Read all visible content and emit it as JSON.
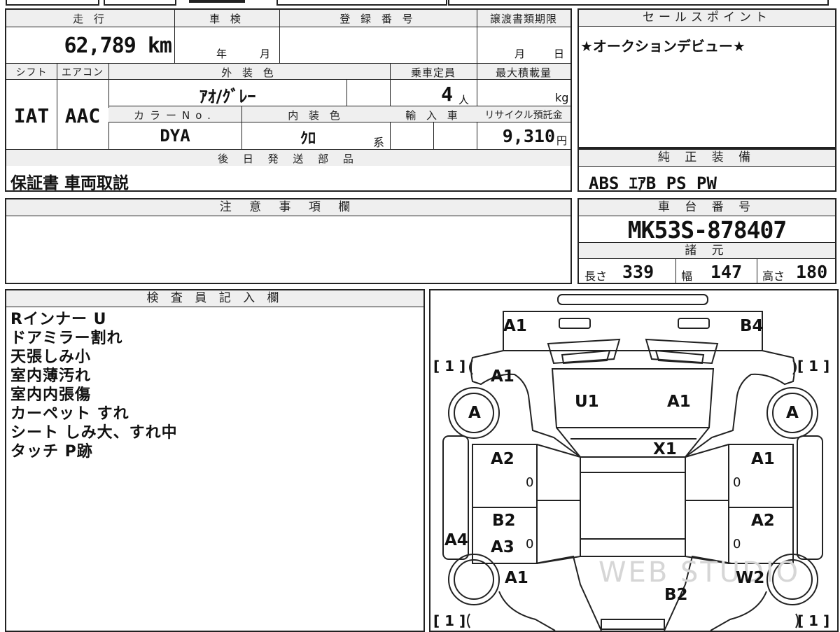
{
  "top_strip": {},
  "mileage": {
    "header": "走 行",
    "value": "62,789 km"
  },
  "inspection": {
    "header": "車 検",
    "year_unit": "年",
    "month_unit": "月"
  },
  "registration": {
    "header": "登 録 番 号"
  },
  "transfer_deadline": {
    "header": "譲渡書類期限",
    "month_unit": "月",
    "day_unit": "日"
  },
  "sales_point": {
    "header": "セールスポイント",
    "text": "★オークションデビュー★"
  },
  "shift": {
    "header": "シフト",
    "value": "IAT"
  },
  "aircon": {
    "header": "エアコン",
    "value": "AAC"
  },
  "exterior_color": {
    "header": "外 装 色",
    "value": "ｱｵ/ｸﾞﾚｰ"
  },
  "capacity": {
    "header": "乗車定員",
    "value": "4",
    "unit": "人"
  },
  "max_load": {
    "header": "最大積載量",
    "unit": "kg"
  },
  "color_no": {
    "header": "カラーNo.",
    "value": "DYA"
  },
  "interior_color": {
    "header": "内 装 色",
    "value": "ｸﾛ",
    "suffix": "系"
  },
  "import": {
    "header": "輸 入 車"
  },
  "recycle": {
    "header": "リサイクル預託金",
    "value": "9,310",
    "unit": "円"
  },
  "later_parts": {
    "header": "後 日 発 送 部 品",
    "value": "保証書 車両取説"
  },
  "genuine_equipment": {
    "header": "純 正 装 備",
    "value": "ABS ｴｱB PS PW"
  },
  "notes": {
    "header": "注 意 事 項 欄"
  },
  "chassis": {
    "header": "車 台 番 号",
    "value": "MK53S-878407"
  },
  "specs": {
    "header": "諸 元",
    "length_label": "長さ",
    "length": "339",
    "width_label": "幅",
    "width": "147",
    "height_label": "高さ",
    "height": "180"
  },
  "inspector": {
    "header": "検 査 員 記 入 欄",
    "lines": [
      "Rインナー U",
      "ドアミラー割れ",
      "天張しみ小",
      "室内薄汚れ",
      "室内内張傷",
      "カーペット すれ",
      "シート しみ大、すれ中",
      "タッチ P跡"
    ]
  },
  "diagram": {
    "watermark": "WEB STUDIO",
    "bracket_tl": "[ 1 ]",
    "bracket_tr": "[ 1 ]",
    "bracket_bl": "[ 1 ]",
    "bracket_br": "[ 1 ]",
    "front_left_top": "A1",
    "front_right_top": "B4",
    "hood_left": "A1",
    "windshield_left": "U1",
    "windshield_right": "A1",
    "roof_front": "X1",
    "left_front_door": "A2",
    "right_front_door": "A1",
    "left_rear_door": "B2",
    "right_rear_door": "A2",
    "left_rear_lower": "A3",
    "left_side": "A4",
    "left_rear_fender": "A1",
    "right_rear_fender": "W2",
    "rear_center": "B2",
    "wheel_fl": "A",
    "wheel_fr": "A",
    "zero": "0"
  }
}
